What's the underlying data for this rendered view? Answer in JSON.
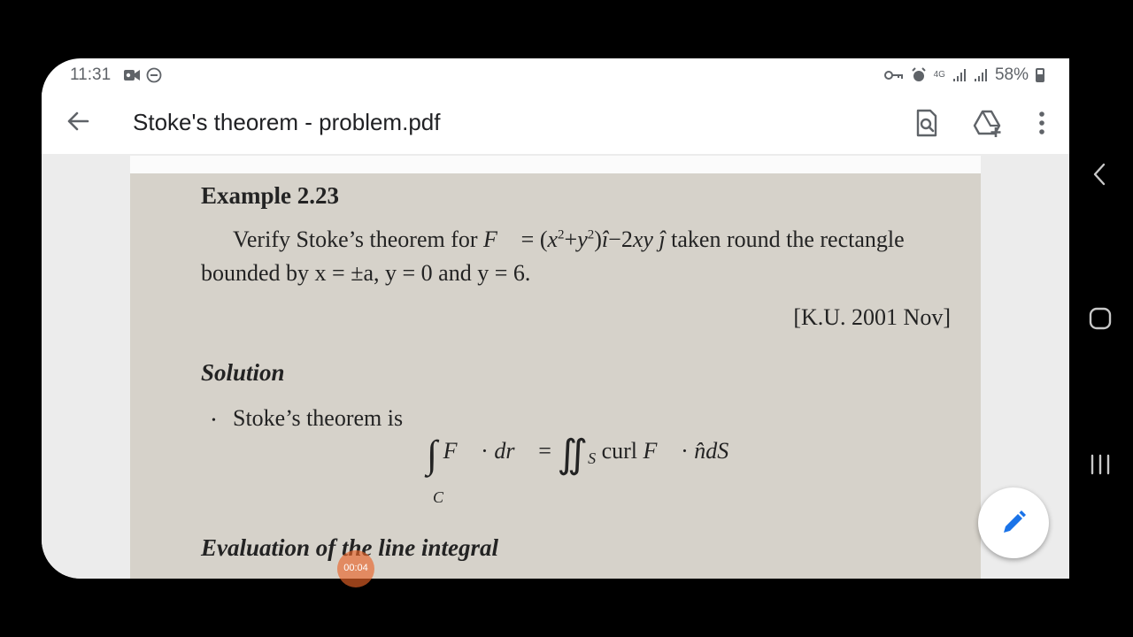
{
  "status_bar": {
    "time": "11:31",
    "network": "4G",
    "battery": "58%"
  },
  "app_bar": {
    "title": "Stoke's theorem - problem.pdf"
  },
  "document": {
    "example_title": "Example 2.23",
    "problem_line1_prefix": "Verify Stoke’s theorem for ",
    "problem_line1_suffix": " taken round the rectangle",
    "problem_line2": "bounded by x = ±a, y = 0 and y = 6.",
    "reference": "[K.U. 2001 Nov]",
    "solution_heading": "Solution",
    "stokes_intro": "Stoke’s theorem is",
    "formula_sub_c": "C",
    "formula_sub_s": "S",
    "formula_curl": "curl",
    "evaluation_heading": "Evaluation of the line integral"
  },
  "recording": {
    "timer": "00:04"
  },
  "colors": {
    "accent_blue": "#1a73e8",
    "page_background": "#d6d2ca",
    "recording_dot": "#e86428"
  }
}
